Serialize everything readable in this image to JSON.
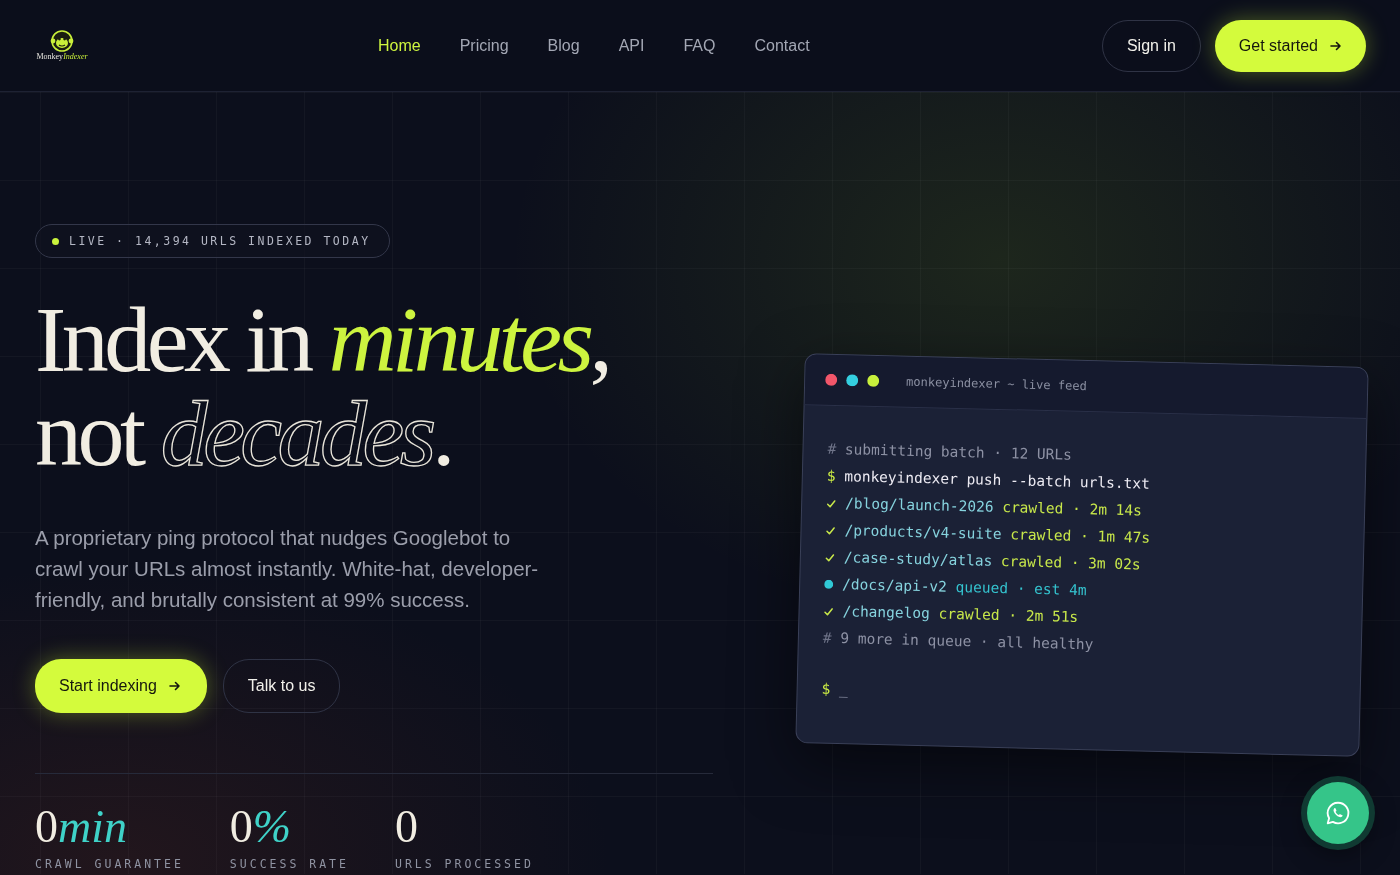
{
  "logo": {
    "word": "Monkey",
    "accent": "Indexer"
  },
  "nav": [
    {
      "label": "Home",
      "selected": true
    },
    {
      "label": "Pricing",
      "selected": false
    },
    {
      "label": "Blog",
      "selected": false
    },
    {
      "label": "API",
      "selected": false
    },
    {
      "label": "FAQ",
      "selected": false
    },
    {
      "label": "Contact",
      "selected": false
    }
  ],
  "header_actions": {
    "sign_in": "Sign in",
    "get_started": "Get started"
  },
  "badge": {
    "text": "LIVE · 14,394 URLS INDEXED TODAY"
  },
  "headline": [
    [
      {
        "kind": "plain",
        "text": "Index in "
      },
      {
        "kind": "accent",
        "text": "minutes"
      },
      {
        "kind": "plain",
        "text": ","
      }
    ],
    [
      {
        "kind": "plain",
        "text": "not "
      },
      {
        "kind": "outline",
        "text": "decades"
      },
      {
        "kind": "plain",
        "text": "."
      }
    ]
  ],
  "description": "A proprietary ping protocol that nudges Googlebot to crawl your URLs almost instantly. White-hat, developer-friendly, and brutally consistent at 99% success.",
  "cta": {
    "primary": "Start indexing",
    "secondary": "Talk to us"
  },
  "stats": [
    {
      "value": "0",
      "unit": "min",
      "label": "CRAWL GUARANTEE"
    },
    {
      "value": "0",
      "unit": "%",
      "label": "SUCCESS RATE"
    },
    {
      "value": "0",
      "label": "URLS PROCESSED"
    }
  ],
  "terminal": {
    "title": "monkeyindexer ~ live feed",
    "lines": [
      {
        "kind": "comment",
        "prefix": "#",
        "text": "submitting batch · 12 URLs"
      },
      {
        "kind": "command",
        "prefix": "$",
        "text": "monkeyindexer push --batch urls.txt"
      },
      {
        "kind": "done",
        "path": "/blog/launch-2026",
        "status": "crawled · 2m 14s"
      },
      {
        "kind": "done",
        "path": "/products/v4-suite",
        "status": "crawled · 1m 47s"
      },
      {
        "kind": "done",
        "path": "/case-study/atlas",
        "status": "crawled · 3m 02s"
      },
      {
        "kind": "queued",
        "path": "/docs/api-v2",
        "status": "queued · est 4m"
      },
      {
        "kind": "done",
        "path": "/changelog",
        "status": "crawled · 2m 51s"
      },
      {
        "kind": "comment",
        "prefix": "#",
        "text": "9 more in queue · all healthy"
      },
      {
        "kind": "prompt",
        "prefix": "$",
        "text": "_"
      }
    ]
  }
}
